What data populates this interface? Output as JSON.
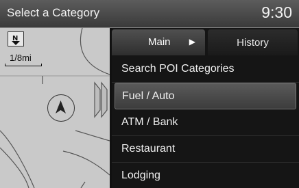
{
  "header": {
    "title": "Select a Category",
    "clock": "9:30"
  },
  "map": {
    "scale": "1/8mi",
    "north_icon": "north-up-icon",
    "vehicle_icon": "vehicle-position-icon"
  },
  "tabs": [
    {
      "label": "Main",
      "selected": true,
      "icon": "play-arrow-icon"
    },
    {
      "label": "History",
      "selected": false
    }
  ],
  "categories": [
    {
      "label": "Search POI Categories",
      "selected": false
    },
    {
      "label": "Fuel / Auto",
      "selected": true
    },
    {
      "label": "ATM / Bank",
      "selected": false
    },
    {
      "label": "Restaurant",
      "selected": false
    },
    {
      "label": "Lodging",
      "selected": false
    }
  ]
}
